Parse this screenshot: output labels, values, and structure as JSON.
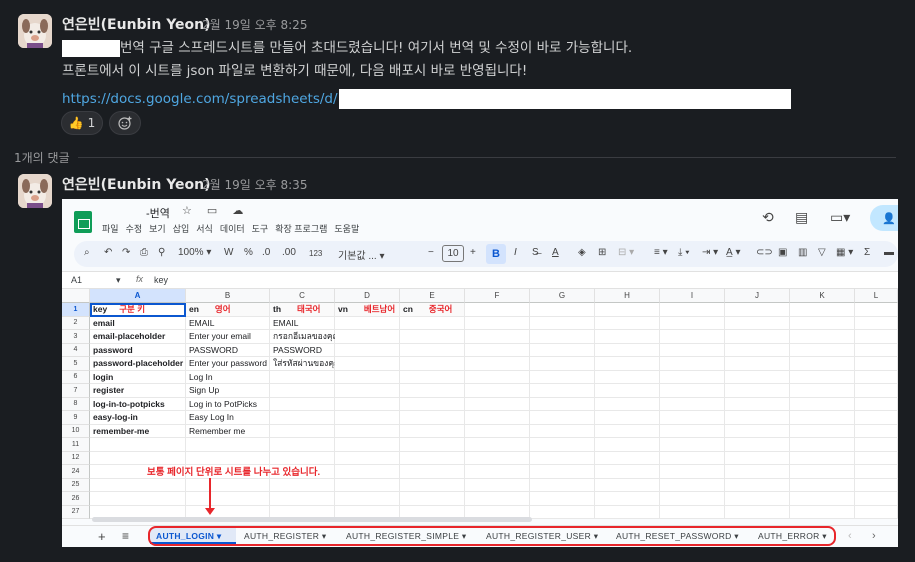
{
  "message1": {
    "author": "연은빈(Eunbin Yeon)",
    "time": "2월 19일 오후 8:25",
    "line1": "번역 구글 스프레드시트를 만들어 초대드렸습니다! 여기서 번역 및 수정이 바로 가능합니다.",
    "line2": "프론트에서 이 시트를 json 파일로 변환하기 때문에, 다음 배포시 바로 반영됩니다!",
    "link": "https://docs.google.com/spreadsheets/d/",
    "reaction_emoji": "👍",
    "reaction_count": "1"
  },
  "thread": {
    "replies": "1개의 댓글"
  },
  "message2": {
    "author": "연은빈(Eunbin Yeon)",
    "time": "2월 19일 오후 8:35"
  },
  "sheets": {
    "title": "-번역",
    "menu": [
      "파일",
      "수정",
      "보기",
      "삽입",
      "서식",
      "데이터",
      "도구",
      "확장 프로그램",
      "도움말"
    ],
    "toolbar": {
      "zoom": "100%",
      "font": "기본값 ...",
      "font_size": "10",
      "currency": "W",
      "percent": "%",
      "dec_less": ".0",
      "dec_more": ".00",
      "num_format": "123"
    },
    "cell_ref": "A1",
    "fx": "fx",
    "formula_value": "key",
    "columns": [
      "A",
      "B",
      "C",
      "D",
      "E",
      "F",
      "G",
      "H",
      "I",
      "J",
      "K",
      "L"
    ],
    "row_numbers": [
      "1",
      "2",
      "3",
      "4",
      "5",
      "6",
      "7",
      "8",
      "9",
      "10",
      "11",
      "12",
      "24",
      "25",
      "26",
      "27"
    ],
    "header_row": {
      "a_key": "key",
      "a_label": "구분 키",
      "b_key": "en",
      "b_label": "영어",
      "c_key": "th",
      "c_label": "태국어",
      "d_key": "vn",
      "d_label": "베트남어",
      "e_key": "cn",
      "e_label": "중국어"
    },
    "rows": [
      [
        "email",
        "EMAIL",
        "EMAIL"
      ],
      [
        "email-placeholder",
        "Enter your email",
        "กรอกอีเมลของคุณ"
      ],
      [
        "password",
        "PASSWORD",
        "PASSWORD"
      ],
      [
        "password-placeholder",
        "Enter your password",
        "ใส่รหัสผ่านของคุณ"
      ],
      [
        "login",
        "Log In",
        ""
      ],
      [
        "register",
        "Sign Up",
        ""
      ],
      [
        "log-in-to-potpicks",
        "Log in to PotPicks",
        ""
      ],
      [
        "easy-log-in",
        "Easy Log In",
        ""
      ],
      [
        "remember-me",
        "Remember me",
        ""
      ]
    ],
    "annotation": "보통 페이지 단위로 시트를 나누고 있습니다.",
    "tabs": [
      "AUTH_LOGIN",
      "AUTH_REGISTER",
      "AUTH_REGISTER_SIMPLE",
      "AUTH_REGISTER_USER",
      "AUTH_RESET_PASSWORD",
      "AUTH_ERROR"
    ],
    "colors": {
      "accent": "#0b57d0",
      "annotation": "#e8262b",
      "sheets_green": "#0f9d58"
    }
  }
}
